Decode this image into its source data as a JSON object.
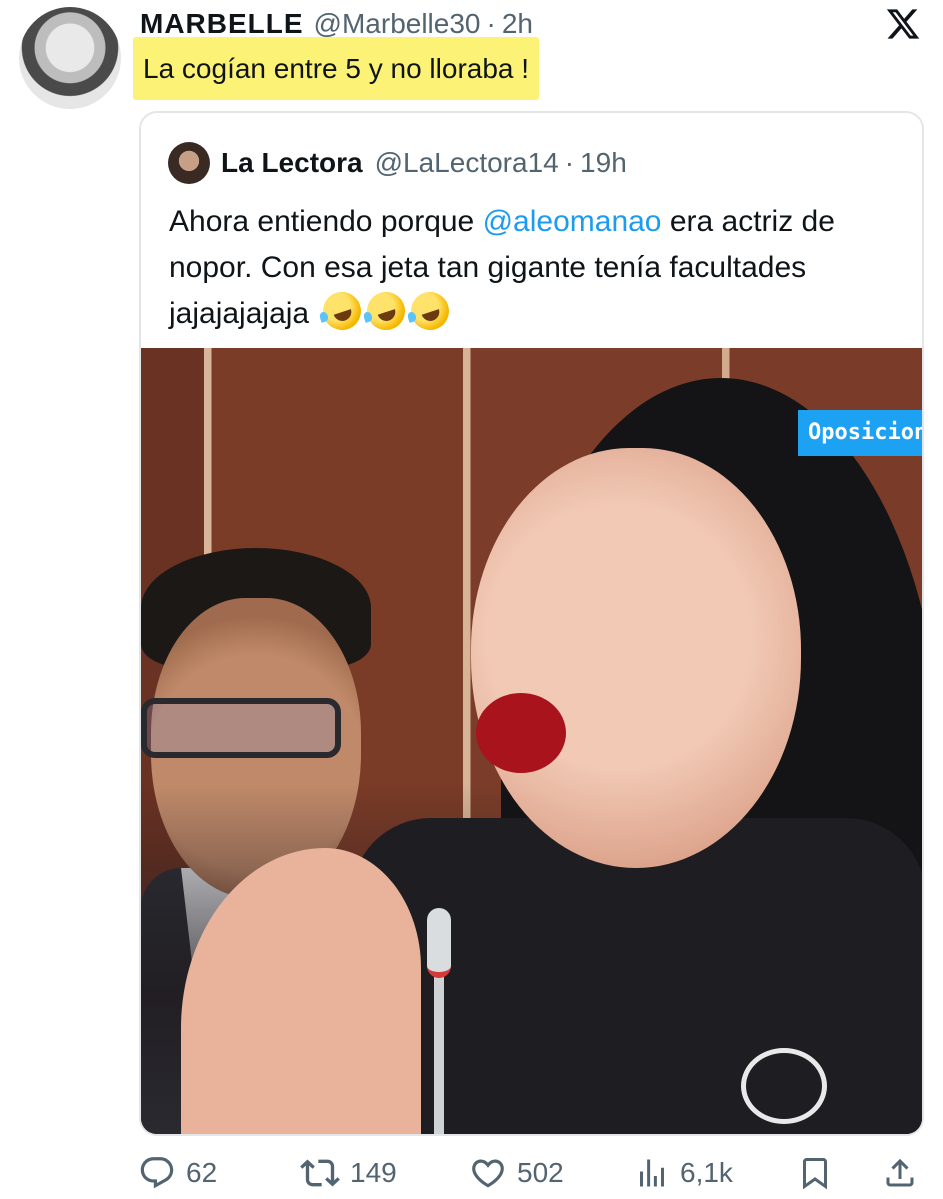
{
  "tweet": {
    "display_name": "MARBELLE",
    "handle": "@Marbelle30",
    "separator": "·",
    "time": "2h",
    "text": "La cogían entre 5 y no lloraba !",
    "highlight_color": "#fbf276"
  },
  "quoted_tweet": {
    "display_name": "La Lectora",
    "handle": "@LaLectora14",
    "separator": "·",
    "time": "19h",
    "text_before_mention": "Ahora entiendo porque ",
    "mention": "@aleomanao",
    "text_after_mention": " era actriz de nopor. Con esa jeta tan gigante tenía facultades jajajajajaja",
    "emojis": [
      "rolling-on-floor-laughing",
      "rolling-on-floor-laughing",
      "rolling-on-floor-laughing"
    ],
    "media": {
      "watermark": "Oposicion_c"
    }
  },
  "actions": {
    "replies": "62",
    "reposts": "149",
    "likes": "502",
    "views": "6,1k"
  },
  "colors": {
    "mention": "#1d9bf0",
    "secondary_text": "#536471",
    "primary_text": "#0f1419"
  }
}
